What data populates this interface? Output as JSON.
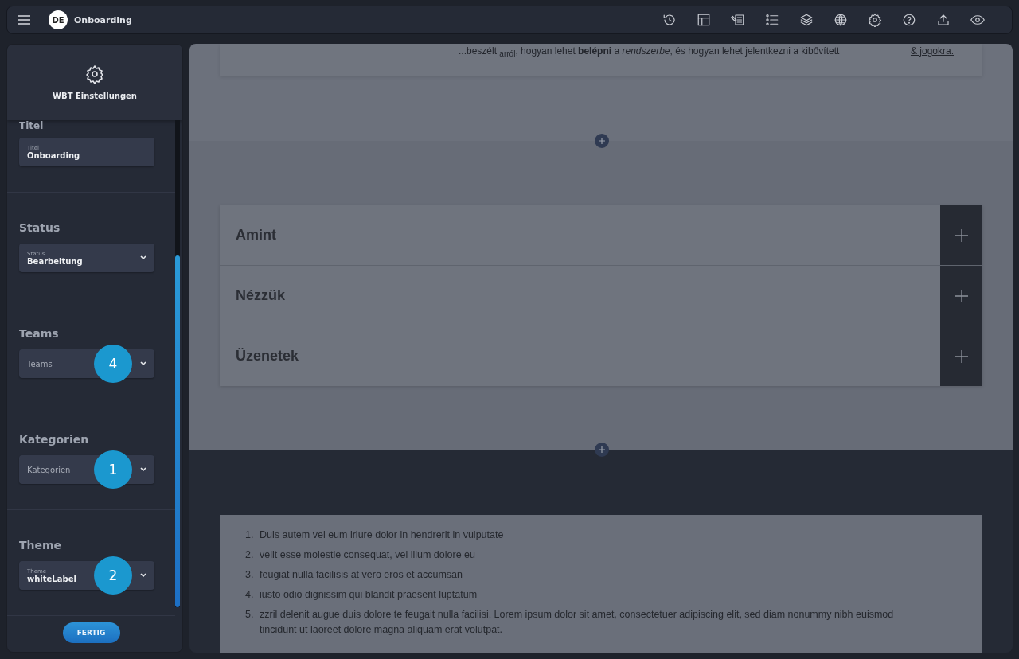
{
  "topbar": {
    "language_badge": "DE",
    "title": "Onboarding"
  },
  "sidebar": {
    "header": {
      "title": "WBT Einstellungen"
    },
    "sections": [
      {
        "heading": "Titel",
        "kind": "text",
        "label": "Titel",
        "value": "Onboarding"
      },
      {
        "heading": "Status",
        "kind": "select",
        "label": "Status",
        "value": "Bearbeitung"
      },
      {
        "heading": "Teams",
        "kind": "select",
        "placeholder": "Teams",
        "step_badge": "4"
      },
      {
        "heading": "Kategorien",
        "kind": "select",
        "placeholder": "Kategorien",
        "step_badge": "1"
      },
      {
        "heading": "Theme",
        "kind": "select",
        "label": "Theme",
        "value": "whiteLabel",
        "step_badge": "2"
      }
    ],
    "done_button": "FERTIG"
  },
  "content": {
    "top_text": "...beszélt $_{arról}$, hogyan lehet **belépni** a *rendszerbe*, és hogyan lehet jelentkezni a kibővített",
    "top_text_end": "& jogokra.",
    "accordion": [
      {
        "title": "Amint",
        "expanded": false
      },
      {
        "title": "Nézzük",
        "expanded": false
      },
      {
        "title": "Üzenetek",
        "expanded": false
      }
    ],
    "list": [
      {
        "number": "1.",
        "text": "Duis autem vel eum iriure dolor in hendrerit in vulputate"
      },
      {
        "number": "2.",
        "text": "velit esse molestie consequat, vel illum dolore eu"
      },
      {
        "number": "3.",
        "text": "feugiat nulla facilisis at vero eros et accumsan"
      },
      {
        "number": "4.",
        "text": "iusto odio dignissim qui blandit praesent luptatum"
      },
      {
        "number": "5.",
        "text": "zzril delenit augue duis dolore te feugait nulla facilisi. Lorem ipsum dolor sit amet, consectetuer adipiscing elit, sed diam nonummy nibh euismod tincidunt ut laoreet dolore magna aliquam erat volutpat."
      }
    ]
  }
}
